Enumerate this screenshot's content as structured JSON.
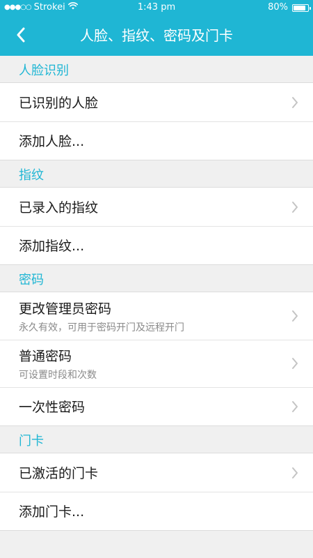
{
  "status_bar": {
    "signal": "●●●○○",
    "carrier": "Strokei",
    "time": "1:43 pm",
    "battery": "80%",
    "battery_level": 0.8
  },
  "nav": {
    "title": "人脸、指纹、密码及门卡",
    "back_icon": "chevron-left-icon"
  },
  "colors": {
    "accent": "#1fb6d4",
    "background": "#f0f0f0",
    "subtitle": "#8a8a8a"
  },
  "sections": {
    "face": {
      "title": "人脸识别",
      "items": [
        {
          "label": "已识别的人脸",
          "has_arrow": true
        },
        {
          "label": "添加人脸..."
        }
      ]
    },
    "fingerprint": {
      "title": "指纹",
      "items": [
        {
          "label": "已录入的指纹",
          "has_arrow": true
        },
        {
          "label": "添加指纹..."
        }
      ]
    },
    "password": {
      "title": "密码",
      "items": [
        {
          "label": "更改管理员密码",
          "sub": "永久有效，可用于密码开门及远程开门",
          "has_arrow": true
        },
        {
          "label": "普通密码",
          "sub": "可设置时段和次数",
          "has_arrow": true
        },
        {
          "label": "一次性密码",
          "has_arrow": true
        }
      ]
    },
    "card": {
      "title": "门卡",
      "items": [
        {
          "label": "已激活的门卡",
          "has_arrow": true
        },
        {
          "label": "添加门卡..."
        }
      ]
    }
  }
}
